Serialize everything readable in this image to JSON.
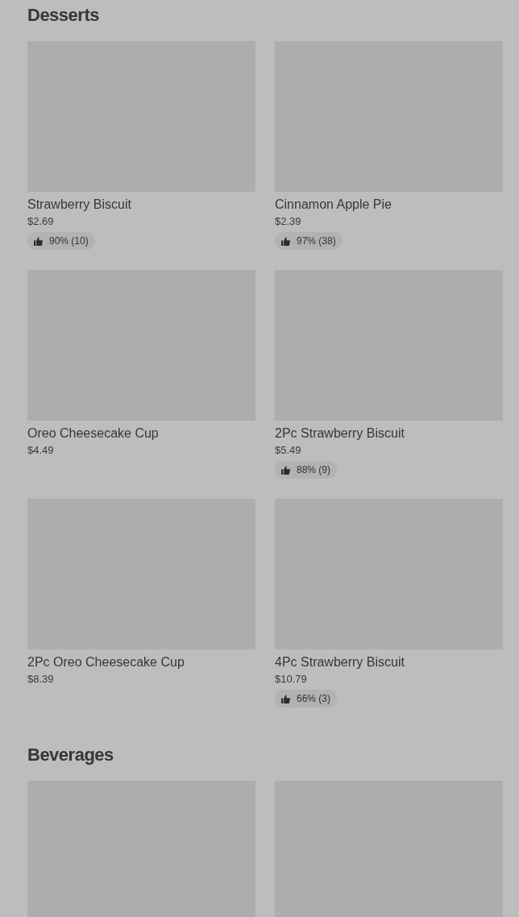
{
  "sections": [
    {
      "title": "Desserts",
      "items": [
        {
          "kind": "picture",
          "name": "Strawberry Biscuit",
          "price": "$2.69",
          "rating": "90% (10)"
        },
        {
          "kind": "picture",
          "name": "Cinnamon Apple Pie",
          "price": "$2.39",
          "rating": "97% (38)"
        },
        {
          "kind": "picture",
          "name": "Oreo Cheesecake Cup",
          "price": "$4.49"
        },
        {
          "kind": "picture",
          "name": "2Pc Strawberry Biscuit",
          "price": "$5.49",
          "rating": "88% (9)"
        },
        {
          "kind": "picture",
          "name": "2Pc Oreo Cheesecake Cup",
          "price": "$8.39"
        },
        {
          "kind": "picture",
          "name": "4Pc Strawberry Biscuit",
          "price": "$10.79",
          "rating": "66% (3)"
        }
      ]
    },
    {
      "title": "Beverages"
    }
  ]
}
